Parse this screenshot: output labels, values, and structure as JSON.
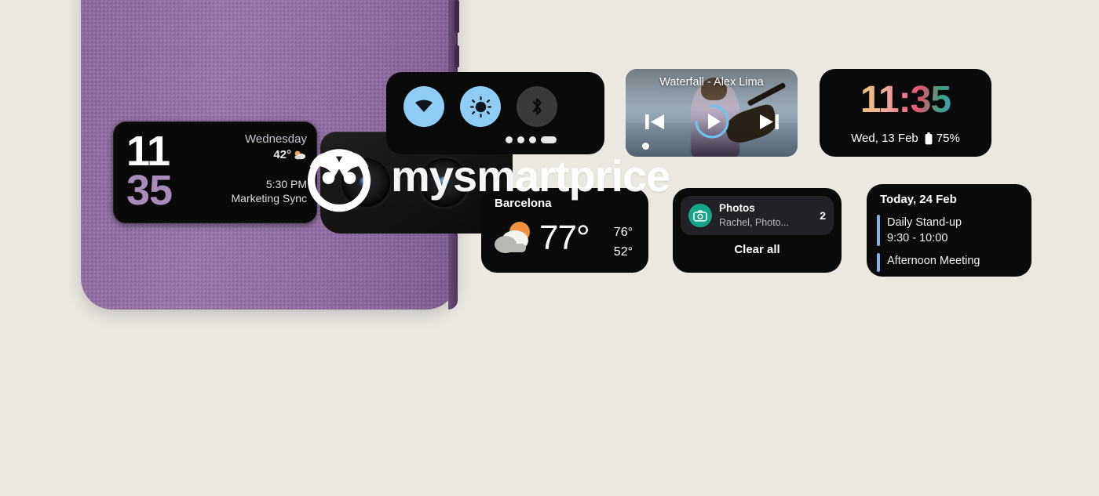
{
  "background_color": "#ebe8e2",
  "phone": {
    "body_color": "#8d6aa0",
    "finish": "purple-leather-texture",
    "cameras": {
      "lens_count": 2,
      "flash": "led-flash"
    },
    "cover_display": {
      "clock_hours": "11",
      "clock_minutes": "35",
      "hours_color": "#ffffff",
      "minutes_color": "#a98cbd",
      "day": "Wednesday",
      "temperature": "42°",
      "weather_icon": "partly-cloudy-icon",
      "event_time": "5:30 PM",
      "event_name": "Marketing Sync"
    }
  },
  "widgets": {
    "quick_settings": {
      "toggles": [
        {
          "icon": "wifi-icon",
          "state": "on"
        },
        {
          "icon": "brightness-icon",
          "state": "on"
        },
        {
          "icon": "bluetooth-icon",
          "state": "off"
        }
      ],
      "page_dots": 4,
      "active_dot_index": 3,
      "accent_on": "#8fcdf5",
      "accent_off": "#3a3a3c"
    },
    "music_player": {
      "title": "Waterfall - Alex Lima",
      "prev_icon": "skip-previous-icon",
      "play_icon": "play-icon",
      "next_icon": "skip-next-icon",
      "progress_percent": 75,
      "ring_color": "#6fc2f0"
    },
    "rainbow_clock": {
      "time": "11:35",
      "date": "Wed, 13 Feb",
      "battery_icon": "battery-icon",
      "battery_percent": "75%"
    },
    "weather": {
      "city": "Barcelona",
      "temperature": "77",
      "degree": "°",
      "high": "76°",
      "low": "52°",
      "icon": "partly-cloudy-icon",
      "sun_color": "#f0913f"
    },
    "notifications": {
      "app_icon": "camera-icon",
      "app_icon_color": "#17a589",
      "app_name": "Photos",
      "preview": "Rachel, Photo...",
      "count": "2",
      "clear_all_label": "Clear all"
    },
    "calendar": {
      "title": "Today, 24 Feb",
      "accent_color": "#7fb0e8",
      "events": [
        {
          "name": "Daily Stand-up",
          "time": "9:30 - 10:00"
        },
        {
          "name": "Afternoon Meeting",
          "time": ""
        }
      ]
    }
  },
  "watermark": {
    "text": "mysmartprice",
    "logo": "owl-logo-icon"
  }
}
